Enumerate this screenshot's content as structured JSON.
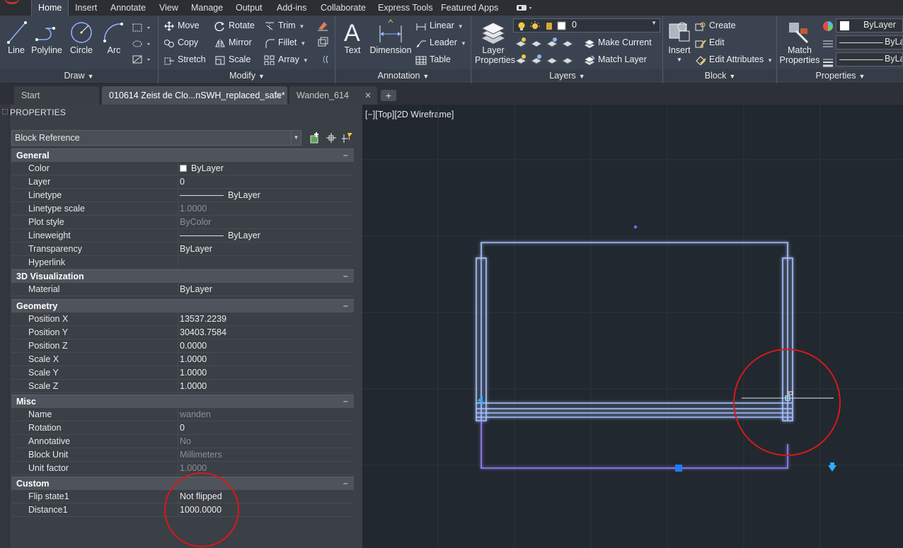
{
  "menubar": {
    "tabs": [
      "Home",
      "Insert",
      "Annotate",
      "View",
      "Manage",
      "Output",
      "Add-ins",
      "Collaborate",
      "Express Tools",
      "Featured Apps"
    ],
    "active_tab": "Home"
  },
  "ribbon": {
    "draw": {
      "title": "Draw",
      "line": "Line",
      "polyline": "Polyline",
      "circle": "Circle",
      "arc": "Arc"
    },
    "modify": {
      "title": "Modify",
      "move": "Move",
      "rotate": "Rotate",
      "trim": "Trim",
      "copy": "Copy",
      "mirror": "Mirror",
      "fillet": "Fillet",
      "stretch": "Stretch",
      "scale": "Scale",
      "array": "Array"
    },
    "annotation": {
      "title": "Annotation",
      "text": "Text",
      "dimension": "Dimension",
      "linear": "Linear",
      "leader": "Leader",
      "table": "Table"
    },
    "layers": {
      "title": "Layers",
      "layer_properties_1": "Layer",
      "layer_properties_2": "Properties",
      "current_layer": "0",
      "make_current": "Make Current",
      "match_layer": "Match Layer"
    },
    "block": {
      "title": "Block",
      "insert": "Insert",
      "create": "Create",
      "edit": "Edit",
      "edit_attributes": "Edit Attributes"
    },
    "properties": {
      "title": "Properties",
      "match_1": "Match",
      "match_2": "Properties",
      "color": "ByLayer",
      "linetype": "ByLay",
      "lineweight": "ByLay"
    }
  },
  "doc_tabs": [
    {
      "label": "Start",
      "active": false,
      "closable": false
    },
    {
      "label": "010614 Zeist de Clo...nSWH_replaced_safe*",
      "active": true,
      "closable": true
    },
    {
      "label": "Wanden_614",
      "active": false,
      "closable": true
    }
  ],
  "properties_panel": {
    "title": "PROPERTIES",
    "object_type": "Block Reference",
    "categories": [
      {
        "name": "General",
        "rows": [
          {
            "key": "Color",
            "value": "ByLayer",
            "kind": "color"
          },
          {
            "key": "Layer",
            "value": "0"
          },
          {
            "key": "Linetype",
            "value": "ByLayer",
            "kind": "linetype"
          },
          {
            "key": "Linetype scale",
            "value": "1.0000",
            "readonly": true
          },
          {
            "key": "Plot style",
            "value": "ByColor",
            "readonly": true
          },
          {
            "key": "Lineweight",
            "value": "ByLayer",
            "kind": "linetype"
          },
          {
            "key": "Transparency",
            "value": "ByLayer"
          },
          {
            "key": "Hyperlink",
            "value": ""
          }
        ]
      },
      {
        "name": "3D Visualization",
        "rows": [
          {
            "key": "Material",
            "value": "ByLayer"
          }
        ]
      },
      {
        "name": "Geometry",
        "rows": [
          {
            "key": "Position X",
            "value": "13537.2239"
          },
          {
            "key": "Position Y",
            "value": "30403.7584"
          },
          {
            "key": "Position Z",
            "value": "0.0000"
          },
          {
            "key": "Scale X",
            "value": "1.0000"
          },
          {
            "key": "Scale Y",
            "value": "1.0000"
          },
          {
            "key": "Scale Z",
            "value": "1.0000"
          }
        ]
      },
      {
        "name": "Misc",
        "rows": [
          {
            "key": "Name",
            "value": "wanden",
            "readonly": true
          },
          {
            "key": "Rotation",
            "value": "0"
          },
          {
            "key": "Annotative",
            "value": "No",
            "readonly": true
          },
          {
            "key": "Block Unit",
            "value": "Millimeters",
            "readonly": true
          },
          {
            "key": "Unit factor",
            "value": "1.0000",
            "readonly": true
          }
        ]
      },
      {
        "name": "Custom",
        "rows": [
          {
            "key": "Flip state1",
            "value": "Not flipped"
          },
          {
            "key": "Distance1",
            "value": "1000.0000"
          }
        ]
      }
    ]
  },
  "viewport": {
    "label": "[−][Top][2D Wireframe]"
  },
  "colors": {
    "accent_blue": "#4f7cff",
    "annotation_red": "#d91818",
    "canvas_bg": "#212830"
  }
}
